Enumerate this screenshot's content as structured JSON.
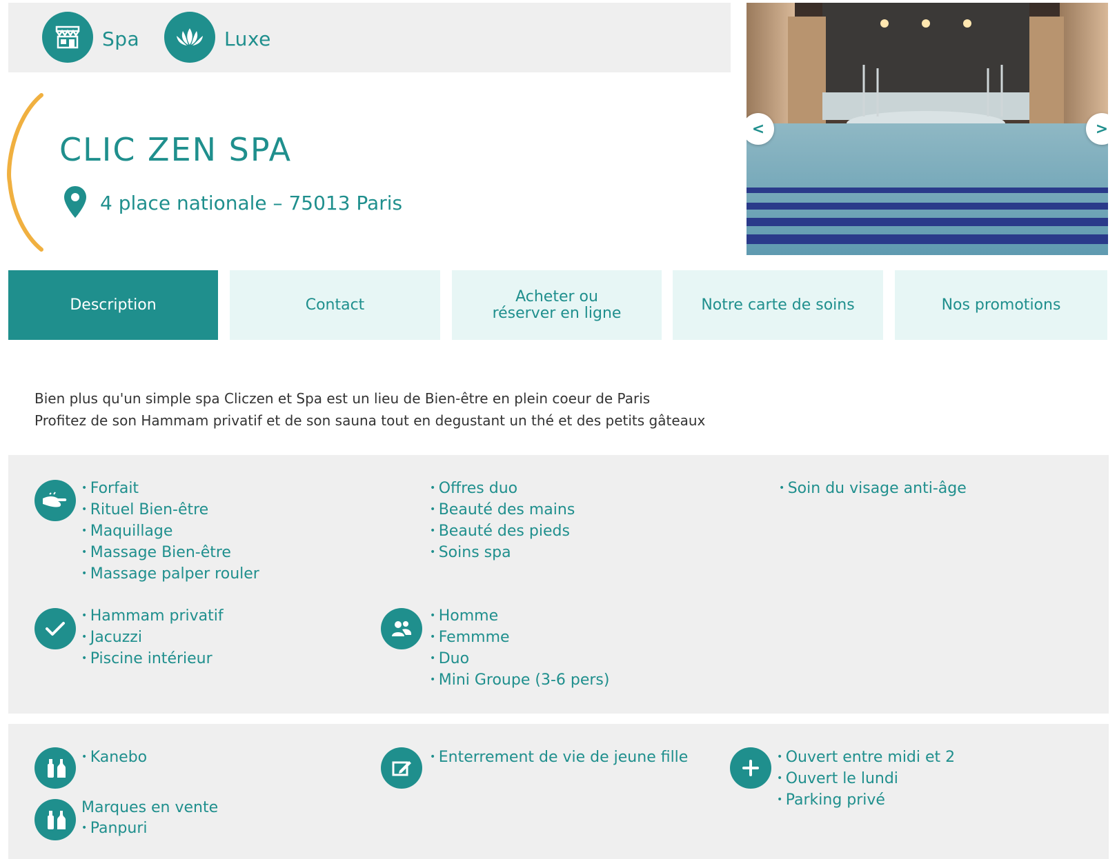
{
  "categories": [
    {
      "label": "Spa",
      "icon": "shop-icon"
    },
    {
      "label": "Luxe",
      "icon": "lotus-icon"
    }
  ],
  "header": {
    "title": "CLIC ZEN SPA",
    "address": "4 place nationale – 75013 Paris"
  },
  "gallery": {
    "prev": "<",
    "next": ">"
  },
  "tabs": [
    {
      "label": "Description"
    },
    {
      "label": "Contact"
    },
    {
      "label": "Acheter ou réserver en ligne"
    },
    {
      "label": "Notre carte de soins"
    },
    {
      "label": "Nos promotions"
    }
  ],
  "description": {
    "line1": "Bien plus qu'un simple spa Cliczen et Spa est un lieu de Bien-être en plein coeur de Paris",
    "line2": "Profitez de son Hammam privatif et de son sauna tout en degustant un thé et des petits gâteaux"
  },
  "services": {
    "col1": [
      "Forfait",
      "Rituel Bien-être",
      "Maquillage",
      "Massage Bien-être",
      "Massage palper rouler"
    ],
    "col2": [
      "Offres duo",
      "Beauté des mains",
      "Beauté des pieds",
      "Soins spa"
    ],
    "col3": [
      "Soin du visage anti-âge"
    ]
  },
  "equipment": [
    "Hammam privatif",
    "Jacuzzi",
    "Piscine intérieur"
  ],
  "clientele": [
    "Homme",
    "Femmme",
    "Duo",
    "Mini Groupe (3-6 pers)"
  ],
  "brands": {
    "used": [
      "Kanebo"
    ],
    "for_sale_label": "Marques en vente",
    "for_sale": [
      "Panpuri"
    ]
  },
  "events": [
    "Enterrement de vie de jeune fille"
  ],
  "extras": [
    "Ouvert entre midi et 2",
    "Ouvert le lundi",
    "Parking privé"
  ],
  "colors": {
    "accent": "#1f8f8d",
    "panel": "#efefef",
    "tab": "#e7f6f5",
    "bracket": "#f0b040"
  }
}
